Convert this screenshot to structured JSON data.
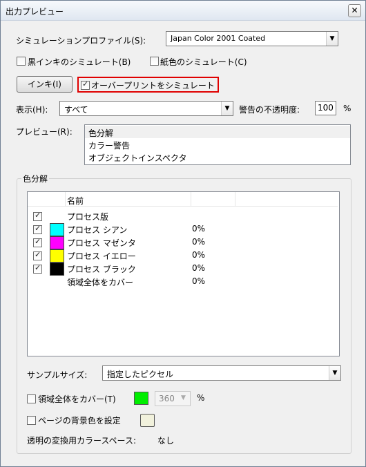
{
  "window": {
    "title": "出力プレビュー",
    "close_glyph": "✕"
  },
  "simulation": {
    "profile_label": "シミュレーションプロファイル(S):",
    "profile_value": "Japan Color 2001 Coated",
    "black_ink_label": "黒インキのシミュレート(B)",
    "paper_color_label": "紙色のシミュレート(C)"
  },
  "ink_button": {
    "label": "インキ(I)"
  },
  "overprint": {
    "label": "オーバープリントをシミュレート",
    "checked": true
  },
  "display": {
    "label": "表示(H):",
    "value": "すべて",
    "warn_opacity_label": "警告の不透明度:",
    "warn_opacity_value": "100",
    "percent": "%"
  },
  "preview": {
    "label": "プレビュー(R):",
    "items": [
      "色分解",
      "カラー警告",
      "オブジェクトインスペクタ"
    ]
  },
  "separations": {
    "group_label": "色分解",
    "column_name": "名前",
    "rows": [
      {
        "name": "プロセス版",
        "checked": true,
        "swatch": null,
        "percent": ""
      },
      {
        "name": "プロセス シアン",
        "checked": true,
        "swatch": "#00ffff",
        "percent": "0%"
      },
      {
        "name": "プロセス マゼンタ",
        "checked": true,
        "swatch": "#ff00ff",
        "percent": "0%"
      },
      {
        "name": "プロセス イエロー",
        "checked": true,
        "swatch": "#ffff00",
        "percent": "0%"
      },
      {
        "name": "プロセス ブラック",
        "checked": true,
        "swatch": "#000000",
        "percent": "0%"
      },
      {
        "name": "領域全体をカバー",
        "checked": false,
        "swatch": null,
        "percent": "0%"
      }
    ]
  },
  "sample_size": {
    "label": "サンプルサイズ:",
    "value": "指定したピクセル"
  },
  "total_coverage": {
    "label": "領域全体をカバー(T)",
    "color": "#00ee00",
    "value": "360",
    "percent": "%"
  },
  "page_bg": {
    "label": "ページの背景色を設定",
    "color": "#f1f1dc"
  },
  "transparency": {
    "label": "透明の変換用カラースペース:",
    "value": "なし"
  },
  "colors": {
    "highlight_border": "#e00000"
  }
}
